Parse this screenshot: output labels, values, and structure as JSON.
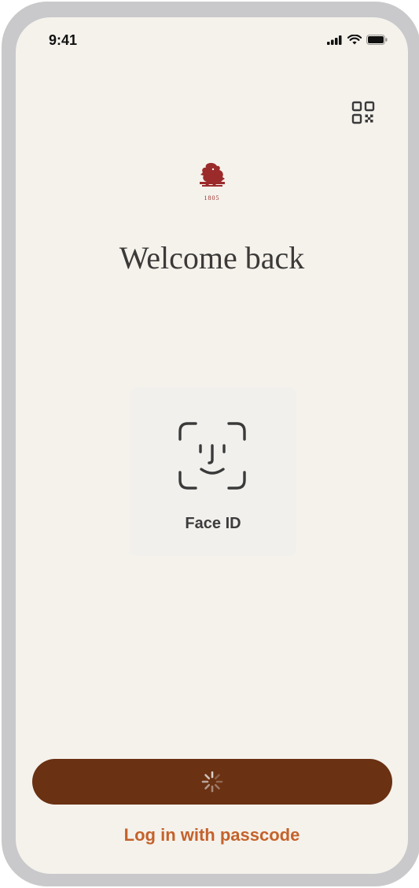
{
  "status_bar": {
    "time": "9:41"
  },
  "icons": {
    "qr": "qr-code-icon",
    "logo": "lion-crest-icon",
    "face_id": "face-id-icon",
    "spinner": "loading-spinner-icon"
  },
  "logo": {
    "year": "1805"
  },
  "header": {
    "title": "Welcome back"
  },
  "face_id": {
    "label": "Face ID"
  },
  "actions": {
    "passcode_label": "Log in with passcode"
  },
  "colors": {
    "background": "#f5f2ec",
    "primary_button": "#6a3112",
    "link": "#c4622b",
    "logo": "#9b2b2b"
  }
}
